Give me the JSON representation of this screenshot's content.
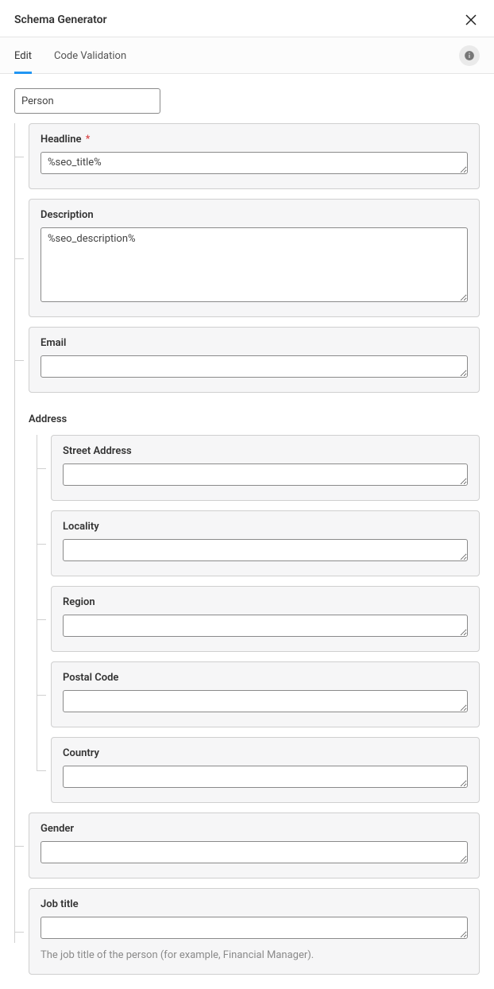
{
  "header": {
    "title": "Schema Generator"
  },
  "tabs": {
    "edit": "Edit",
    "code": "Code Validation",
    "activeIndex": 0
  },
  "schema": {
    "type": "Person",
    "fields": {
      "headline": {
        "label": "Headline",
        "required": "*",
        "value": "%seo_title%"
      },
      "description": {
        "label": "Description",
        "value": "%seo_description%"
      },
      "email": {
        "label": "Email",
        "value": ""
      },
      "gender": {
        "label": "Gender",
        "value": ""
      },
      "jobTitle": {
        "label": "Job title",
        "value": "",
        "helper": "The job title of the person (for example, Financial Manager)."
      }
    },
    "address": {
      "heading": "Address",
      "street": {
        "label": "Street Address",
        "value": ""
      },
      "locality": {
        "label": "Locality",
        "value": ""
      },
      "region": {
        "label": "Region",
        "value": ""
      },
      "postal": {
        "label": "Postal Code",
        "value": ""
      },
      "country": {
        "label": "Country",
        "value": ""
      }
    }
  }
}
